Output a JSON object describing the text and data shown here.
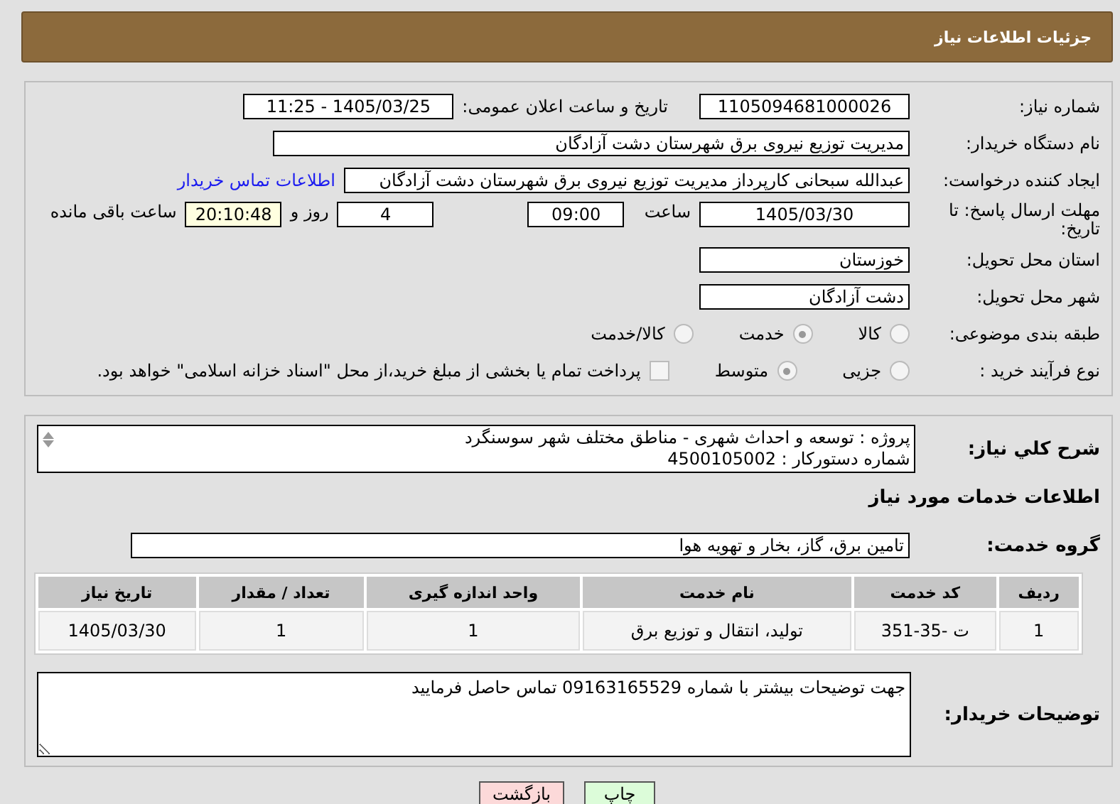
{
  "header": {
    "title": "جزئیات اطلاعات نیاز"
  },
  "need_number": {
    "label": "شماره نیاز:",
    "value": "1105094681000026"
  },
  "announce": {
    "label": "تاریخ و ساعت اعلان عمومی:",
    "value": "1405/03/25 - 11:25"
  },
  "buyer_org": {
    "label": "نام دستگاه خریدار:",
    "value": "مدیریت توزیع نیروی برق شهرستان دشت آزادگان"
  },
  "requester": {
    "label": "ایجاد کننده درخواست:",
    "value": "عبدالله سبحانی کارپرداز مدیریت توزیع نیروی برق شهرستان دشت آزادگان",
    "link": "اطلاعات تماس خریدار"
  },
  "deadline": {
    "label": "مهلت ارسال پاسخ: تا تاریخ:",
    "date": "1405/03/30",
    "time_label": "ساعت",
    "time": "09:00",
    "days": "4",
    "days_label": "روز و",
    "remaining": "20:10:48",
    "remaining_label": "ساعت باقی مانده"
  },
  "province": {
    "label": "استان محل تحویل:",
    "value": "خوزستان"
  },
  "city": {
    "label": "شهر محل تحویل:",
    "value": "دشت آزادگان"
  },
  "category": {
    "label": "طبقه بندی موضوعی:",
    "options": [
      {
        "label": "کالا",
        "selected": false
      },
      {
        "label": "خدمت",
        "selected": true
      },
      {
        "label": "کالا/خدمت",
        "selected": false
      }
    ]
  },
  "purchase_type": {
    "label": "نوع فرآیند خرید :",
    "options": [
      {
        "label": "جزیی",
        "selected": false
      },
      {
        "label": "متوسط",
        "selected": true
      }
    ],
    "payment": {
      "label": "پرداخت تمام یا بخشی از مبلغ خرید،از محل \"اسناد خزانه اسلامی\" خواهد بود.",
      "checked": false
    }
  },
  "description": {
    "label": "شرح کلي نياز:",
    "lines": [
      "پروژه : توسعه و احداث شهری - مناطق مختلف شهر سوسنگرد",
      "شماره دستورکار : 4500105002"
    ]
  },
  "services_title": "اطلاعات خدمات مورد نیاز",
  "service_group": {
    "label": "گروه خدمت:",
    "value": "تامین برق، گاز، بخار و تهویه هوا"
  },
  "table": {
    "columns": [
      "ردیف",
      "کد خدمت",
      "نام خدمت",
      "واحد اندازه گیری",
      "تعداد / مقدار",
      "تاریخ نیاز"
    ],
    "rows": [
      [
        "1",
        "ت -35-351",
        "تولید، انتقال و توزیع برق",
        "1",
        "1",
        "1405/03/30"
      ]
    ]
  },
  "buyer_notes": {
    "label": "توضیحات خریدار:",
    "value": "جهت توضیحات بیشتر با شماره 09163165529 تماس حاصل فرمایید"
  },
  "buttons": [
    {
      "label": "چاپ",
      "kind": "print"
    },
    {
      "label": "بازگشت",
      "kind": "back"
    }
  ]
}
